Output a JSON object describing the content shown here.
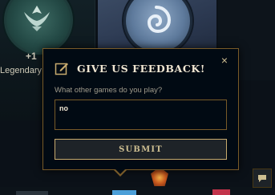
{
  "background": {
    "card_left": {
      "badge": "+1",
      "tier_label": "Legendary"
    }
  },
  "modal": {
    "title": "GIVE US FEEDBACK!",
    "close_label": "×",
    "question": "What other games do you play?",
    "answer_value": "no",
    "submit_label": "SUBMIT"
  },
  "icons": {
    "header": "edit-note-icon",
    "close": "close-icon",
    "chat": "chat-bubble-icon"
  },
  "colors": {
    "modal_bg": "#010a13",
    "gold_border": "#785a28",
    "gold_text": "#cdbe91",
    "title_text": "#f0e6d2",
    "muted_text": "#a09b8c"
  }
}
